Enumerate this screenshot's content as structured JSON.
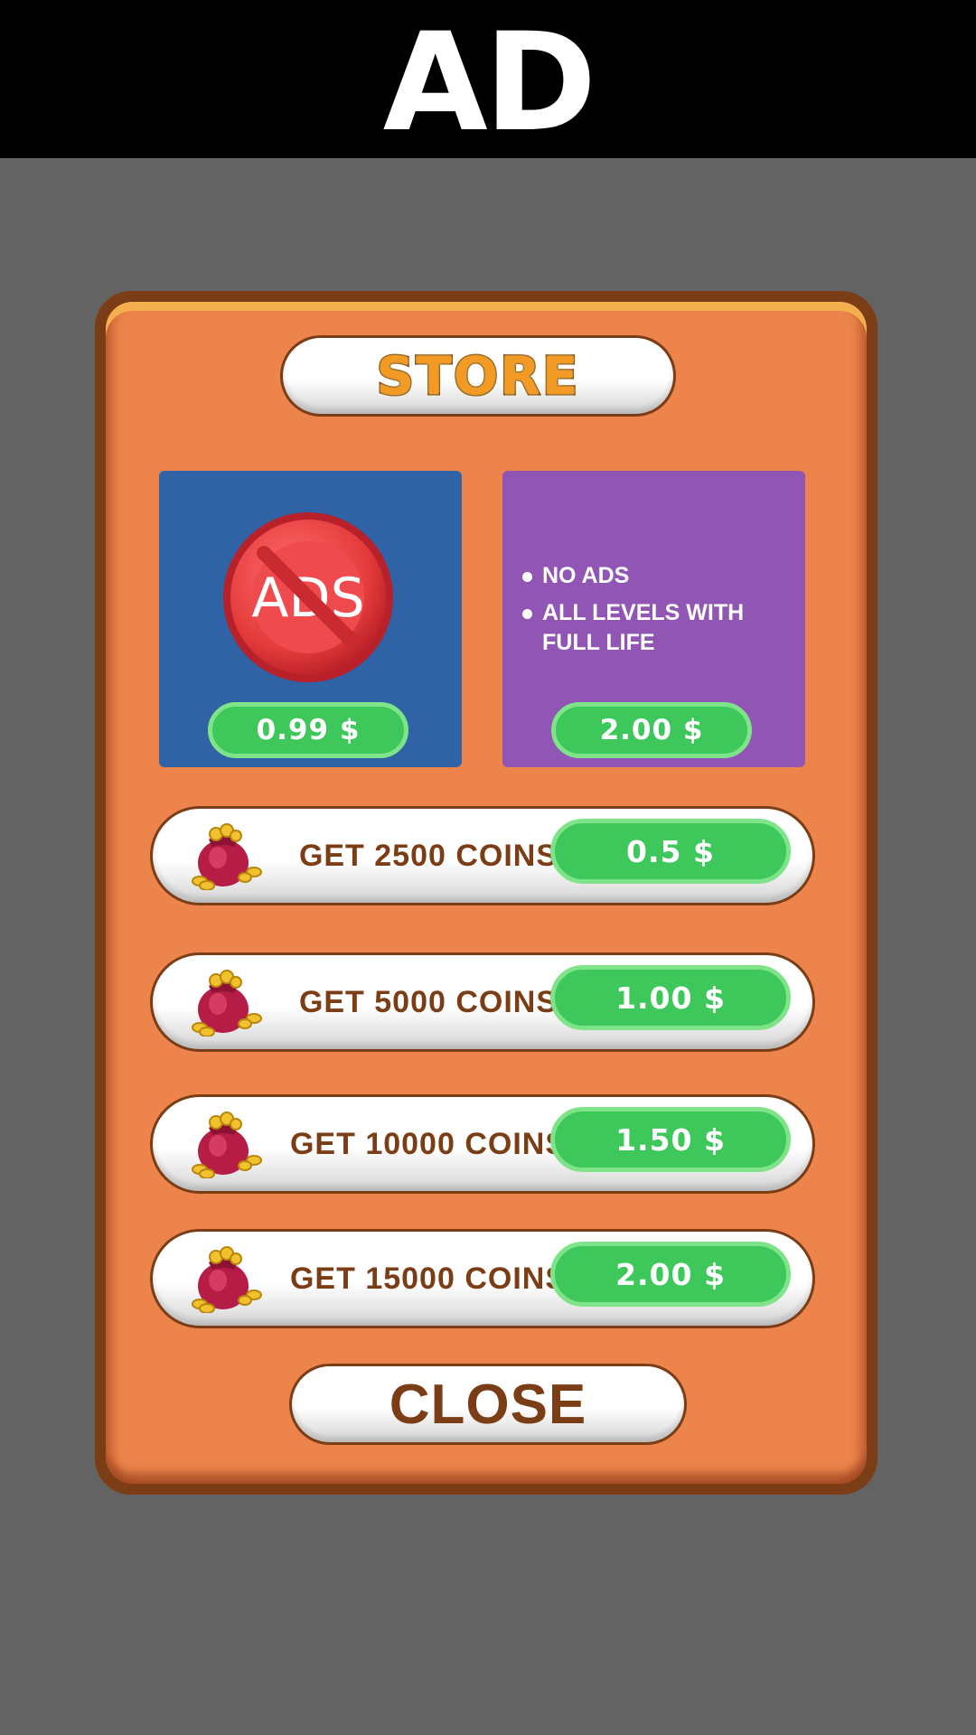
{
  "ad_banner": {
    "label": "AD"
  },
  "store": {
    "title": "STORE",
    "no_ads_card": {
      "icon": "no-ads-icon",
      "icon_text": "ADS",
      "price": "0.99 $",
      "background": "#3063a5"
    },
    "vip_card": {
      "features": [
        "NO ADS",
        "ALL LEVELS WITH FULL LIFE"
      ],
      "price": "2.00 $",
      "background": "#9155b3"
    },
    "coin_packs": [
      {
        "label": "GET 2500 COINS",
        "price": "0.5 $",
        "icon": "coin-bag-icon"
      },
      {
        "label": "GET 5000 COINS",
        "price": "1.00 $",
        "icon": "coin-bag-icon"
      },
      {
        "label": "GET 10000 COINS",
        "price": "1.50 $",
        "icon": "coin-bag-icon"
      },
      {
        "label": "GET 15000 COINS",
        "price": "2.00 $",
        "icon": "coin-bag-icon"
      }
    ],
    "close_label": "CLOSE"
  },
  "colors": {
    "background": "#636363",
    "panel_frame": "#7a3d16",
    "panel_fill": "#ec844c",
    "price_green": "#3ec75a",
    "text_brown": "#7a3d16"
  }
}
